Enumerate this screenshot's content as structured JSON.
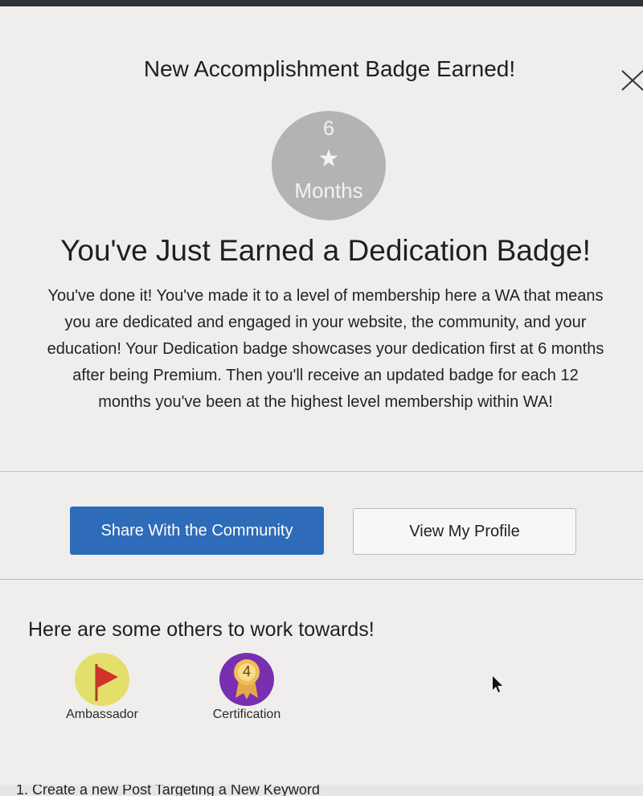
{
  "modal": {
    "header_title": "New Accomplishment Badge Earned!",
    "badge": {
      "number": "6",
      "icon": "star-icon",
      "unit": "Months",
      "color": "#b4b3b1"
    },
    "headline": "You've Just Earned a Dedication Badge!",
    "description": "You've done it! You've made it to a level of membership here a WA that means you are dedicated and engaged in your website, the community, and your education! Your Dedication badge showcases your dedication first at 6 months after being Premium. Then you'll receive an updated badge for each 12 months you've been at the highest level membership within WA!",
    "buttons": {
      "share_label": "Share With the Community",
      "profile_label": "View My Profile"
    },
    "others": {
      "title": "Here are some others to work towards!",
      "badges": [
        {
          "label": "Ambassador",
          "icon": "flag-icon",
          "color": "#e3df6b"
        },
        {
          "label": "Certification",
          "icon": "rosette-icon",
          "number": "4",
          "color": "#7a2fb0"
        }
      ]
    }
  },
  "footer": {
    "text": "1. Create a new Post Targeting a New Keyword"
  },
  "colors": {
    "primary": "#2e6bb8",
    "background": "#efeeec"
  }
}
